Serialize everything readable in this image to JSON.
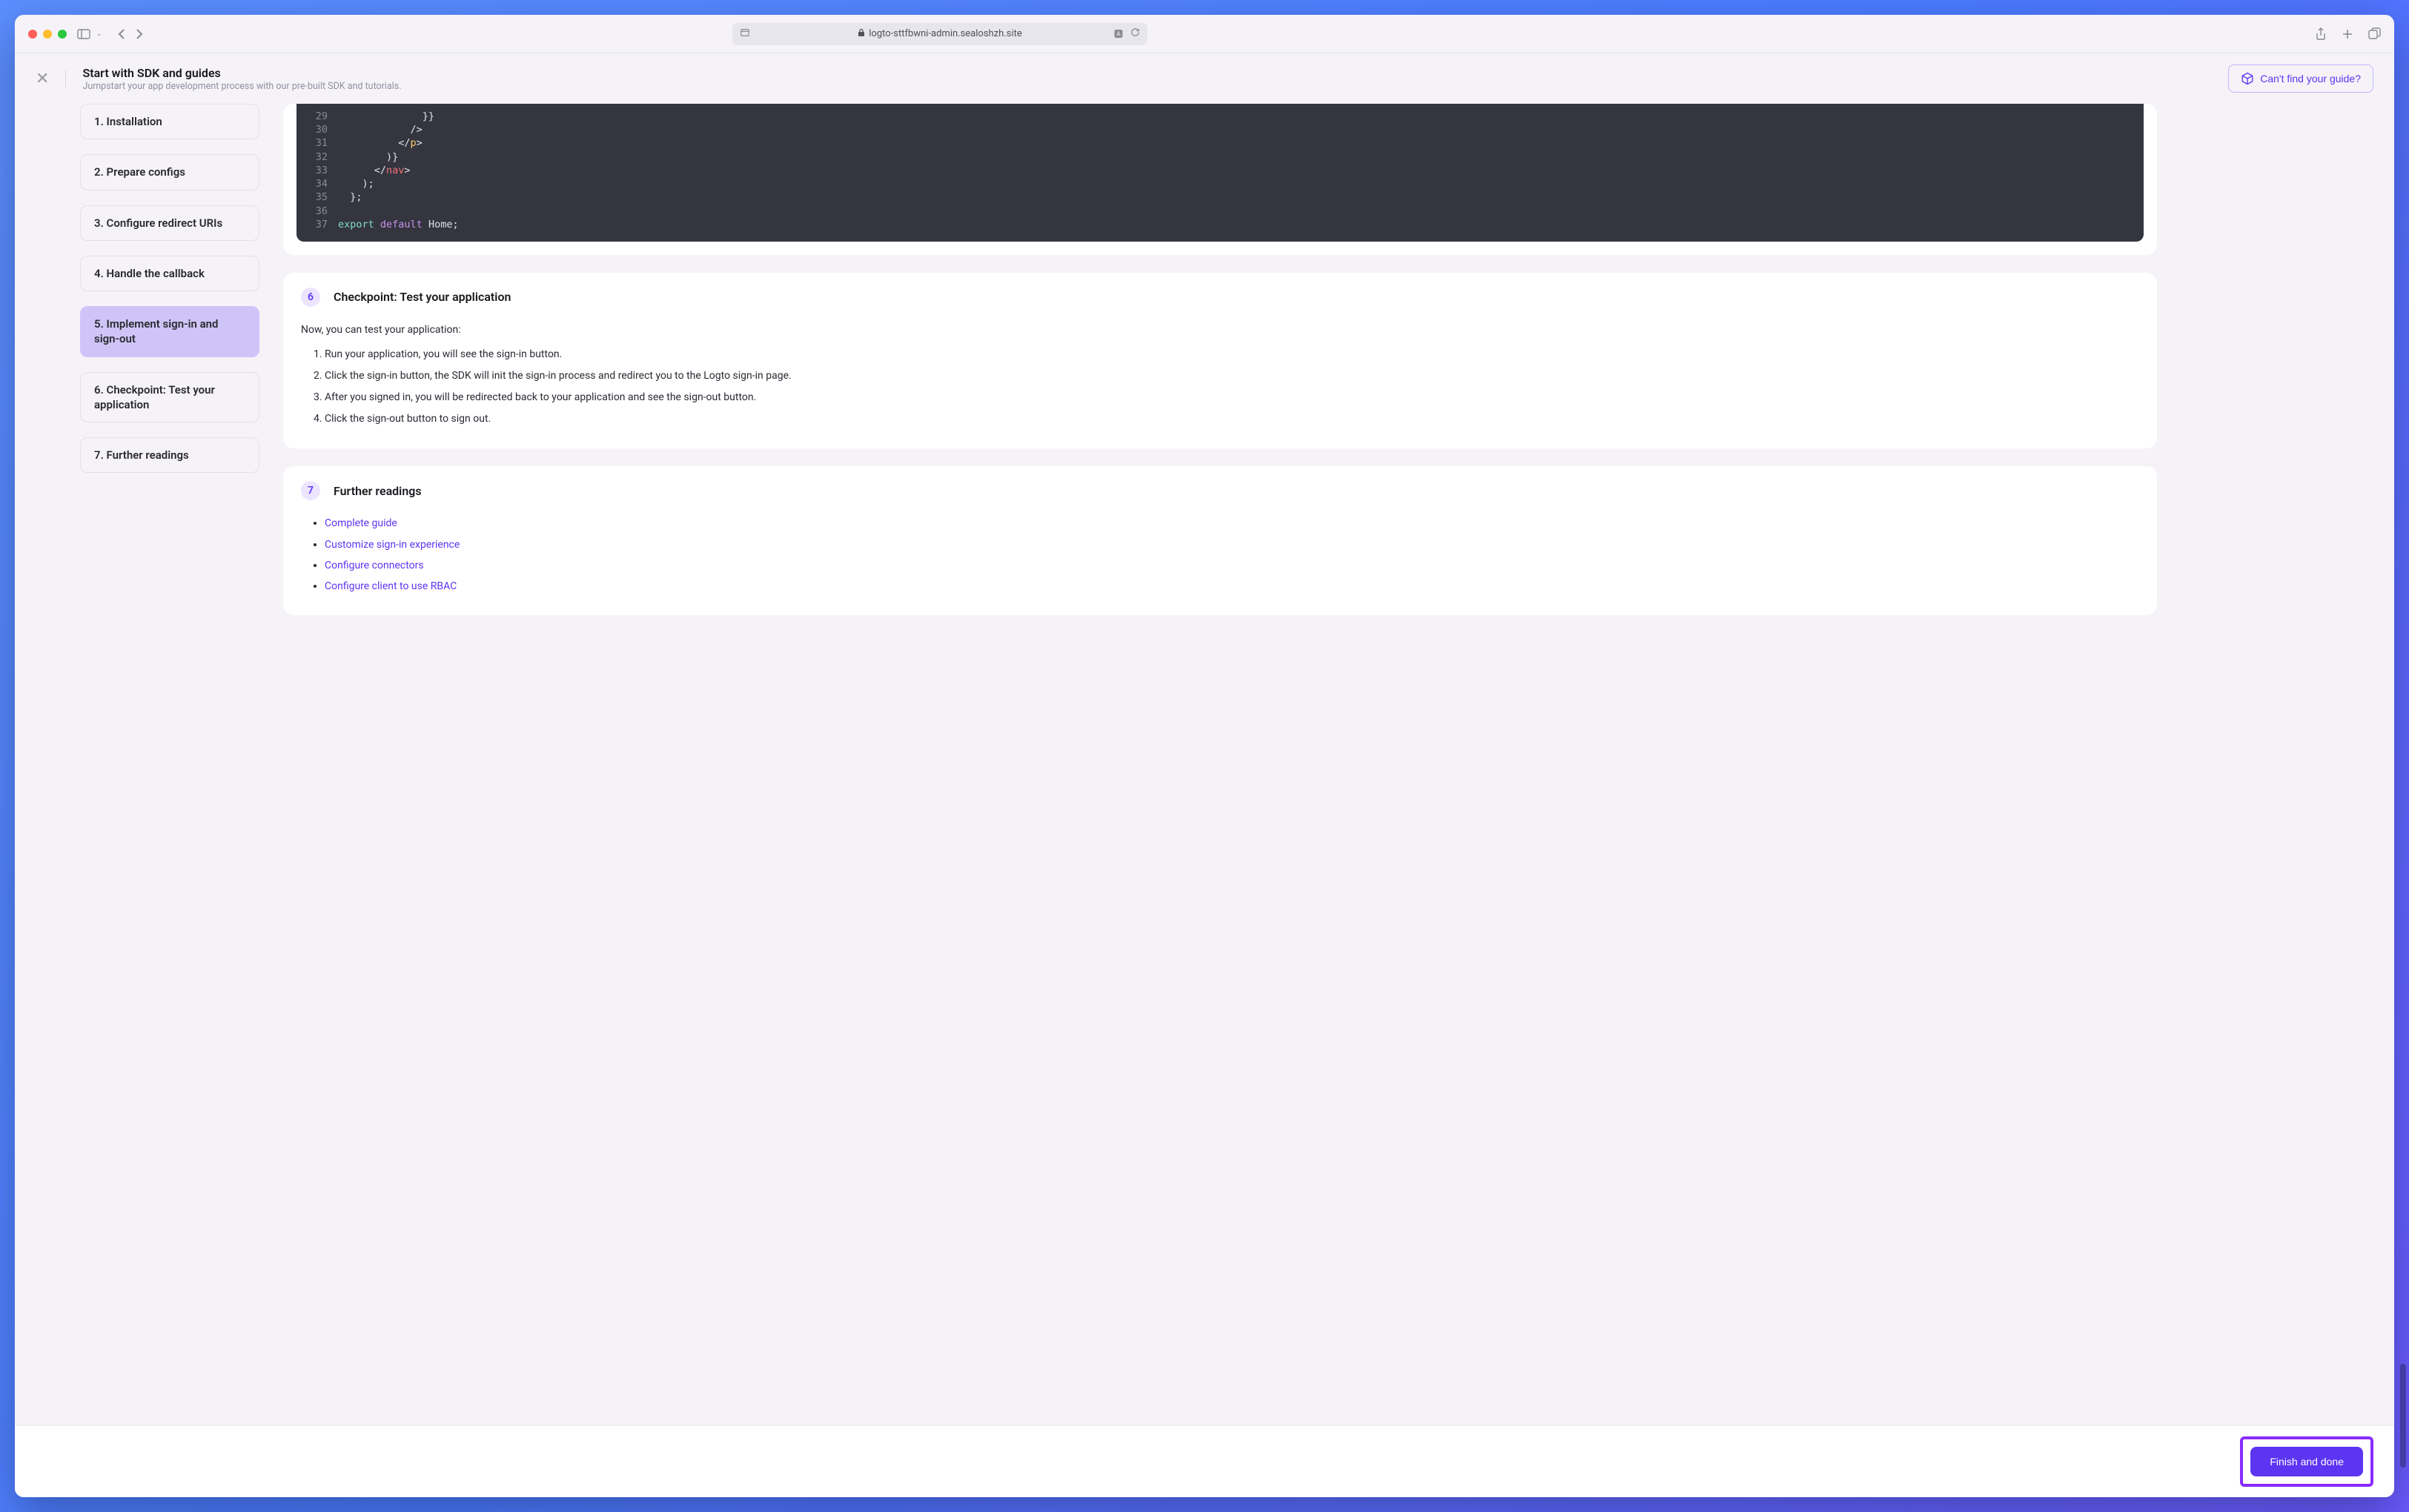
{
  "browser": {
    "url": "logto-sttfbwni-admin.sealoshzh.site"
  },
  "header": {
    "title": "Start with SDK and guides",
    "subtitle": "Jumpstart your app development process with our pre-built SDK and tutorials.",
    "cant_find_label": "Can't find your guide?"
  },
  "sidebar": {
    "items": [
      {
        "label": "1. Installation"
      },
      {
        "label": "2. Prepare configs"
      },
      {
        "label": "3. Configure redirect URIs"
      },
      {
        "label": "4. Handle the callback"
      },
      {
        "label": "5. Implement sign-in and sign-out"
      },
      {
        "label": "6. Checkpoint: Test your application"
      },
      {
        "label": "7. Further readings"
      }
    ],
    "active_index": 4
  },
  "code": {
    "lines": [
      {
        "no": "29",
        "pre": "              ",
        "raw": "}}"
      },
      {
        "no": "30",
        "pre": "            ",
        "raw": "/>"
      },
      {
        "no": "31",
        "pre": "          ",
        "tagClose": true,
        "name": "p"
      },
      {
        "no": "32",
        "pre": "        ",
        "raw": ")}"
      },
      {
        "no": "33",
        "pre": "      ",
        "tagClose": true,
        "name": "nav"
      },
      {
        "no": "34",
        "pre": "    ",
        "raw": ");"
      },
      {
        "no": "35",
        "pre": "  ",
        "raw": "};"
      },
      {
        "no": "36",
        "pre": "",
        "raw": ""
      },
      {
        "no": "37",
        "pre": "",
        "export": true
      }
    ],
    "export_home": "Home"
  },
  "step6": {
    "number": "6",
    "title": "Checkpoint: Test your application",
    "intro": "Now, you can test your application:",
    "steps": [
      "Run your application, you will see the sign-in button.",
      "Click the sign-in button, the SDK will init the sign-in process and redirect you to the Logto sign-in page.",
      "After you signed in, you will be redirected back to your application and see the sign-out button.",
      "Click the sign-out button to sign out."
    ]
  },
  "step7": {
    "number": "7",
    "title": "Further readings",
    "links": [
      "Complete guide",
      "Customize sign-in experience",
      "Configure connectors",
      "Configure client to use RBAC"
    ]
  },
  "footer": {
    "finish_label": "Finish and done"
  }
}
